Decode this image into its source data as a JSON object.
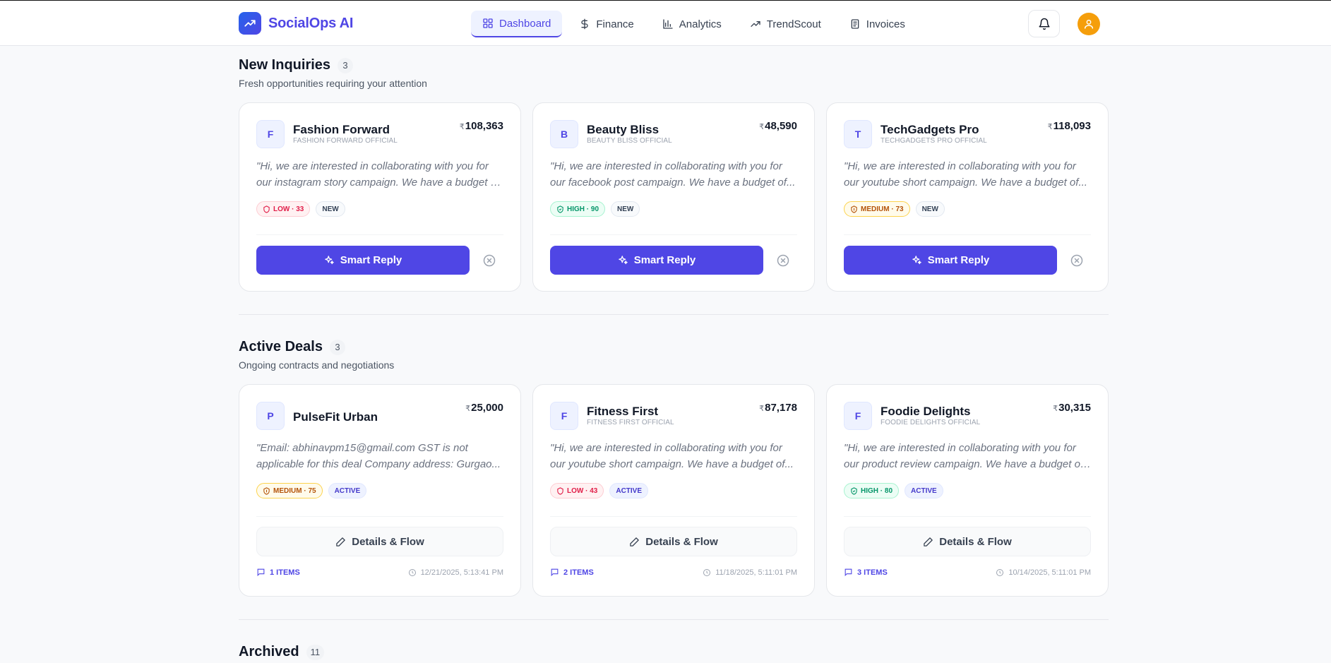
{
  "header": {
    "app_name": "SocialOps AI",
    "nav": [
      {
        "label": "Dashboard",
        "icon": "grid-icon",
        "active": true
      },
      {
        "label": "Finance",
        "icon": "dollar-icon",
        "active": false
      },
      {
        "label": "Analytics",
        "icon": "bar-chart-icon",
        "active": false
      },
      {
        "label": "TrendScout",
        "icon": "trending-up-icon",
        "active": false
      },
      {
        "label": "Invoices",
        "icon": "document-icon",
        "active": false
      }
    ],
    "accent": "#4f46e5"
  },
  "inquiries": {
    "title": "New Inquiries",
    "count": "3",
    "subtitle": "Fresh opportunities requiring your attention",
    "action_label": "Smart Reply",
    "cards": [
      {
        "initial": "F",
        "name": "Fashion Forward",
        "handle": "FASHION FORWARD OFFICIAL",
        "currency": "₹",
        "amount": "108,363",
        "msg1": "\"Hi, we are interested in collaborating with you for",
        "msg2": "our instagram story campaign. We have a budget of...",
        "risk": "LOW · 33",
        "risk_level": "low",
        "status": "NEW"
      },
      {
        "initial": "B",
        "name": "Beauty Bliss",
        "handle": "BEAUTY BLISS OFFICIAL",
        "currency": "₹",
        "amount": "48,590",
        "msg1": "\"Hi, we are interested in collaborating with you for",
        "msg2": "our facebook post campaign. We have a budget of...",
        "risk": "HIGH · 90",
        "risk_level": "high",
        "status": "NEW"
      },
      {
        "initial": "T",
        "name": "TechGadgets Pro",
        "handle": "TECHGADGETS PRO OFFICIAL",
        "currency": "₹",
        "amount": "118,093",
        "msg1": "\"Hi, we are interested in collaborating with you for",
        "msg2": "our youtube short campaign. We have a budget of...",
        "risk": "MEDIUM · 73",
        "risk_level": "medium",
        "status": "NEW"
      }
    ]
  },
  "deals": {
    "title": "Active Deals",
    "count": "3",
    "subtitle": "Ongoing contracts and negotiations",
    "action_label": "Details & Flow",
    "cards": [
      {
        "initial": "P",
        "name": "PulseFit Urban",
        "handle": "",
        "currency": "₹",
        "amount": "25,000",
        "msg1": "\"Email: abhinavpm15@gmail.com GST is not",
        "msg2": "applicable for this deal Company address: Gurgao...",
        "risk": "MEDIUM · 75",
        "risk_level": "medium",
        "status": "ACTIVE",
        "items": "1 ITEMS",
        "timestamp": "12/21/2025, 5:13:41 PM"
      },
      {
        "initial": "F",
        "name": "Fitness First",
        "handle": "FITNESS FIRST OFFICIAL",
        "currency": "₹",
        "amount": "87,178",
        "msg1": "\"Hi, we are interested in collaborating with you for",
        "msg2": "our youtube short campaign. We have a budget of...",
        "risk": "LOW · 43",
        "risk_level": "low",
        "status": "ACTIVE",
        "items": "2 ITEMS",
        "timestamp": "11/18/2025, 5:11:01 PM"
      },
      {
        "initial": "F",
        "name": "Foodie Delights",
        "handle": "FOODIE DELIGHTS OFFICIAL",
        "currency": "₹",
        "amount": "30,315",
        "msg1": "\"Hi, we are interested in collaborating with you for",
        "msg2": "our product review campaign. We have a budget of...",
        "risk": "HIGH · 80",
        "risk_level": "high",
        "status": "ACTIVE",
        "items": "3 ITEMS",
        "timestamp": "10/14/2025, 5:11:01 PM"
      }
    ]
  },
  "archived": {
    "title": "Archived",
    "count": "11"
  }
}
